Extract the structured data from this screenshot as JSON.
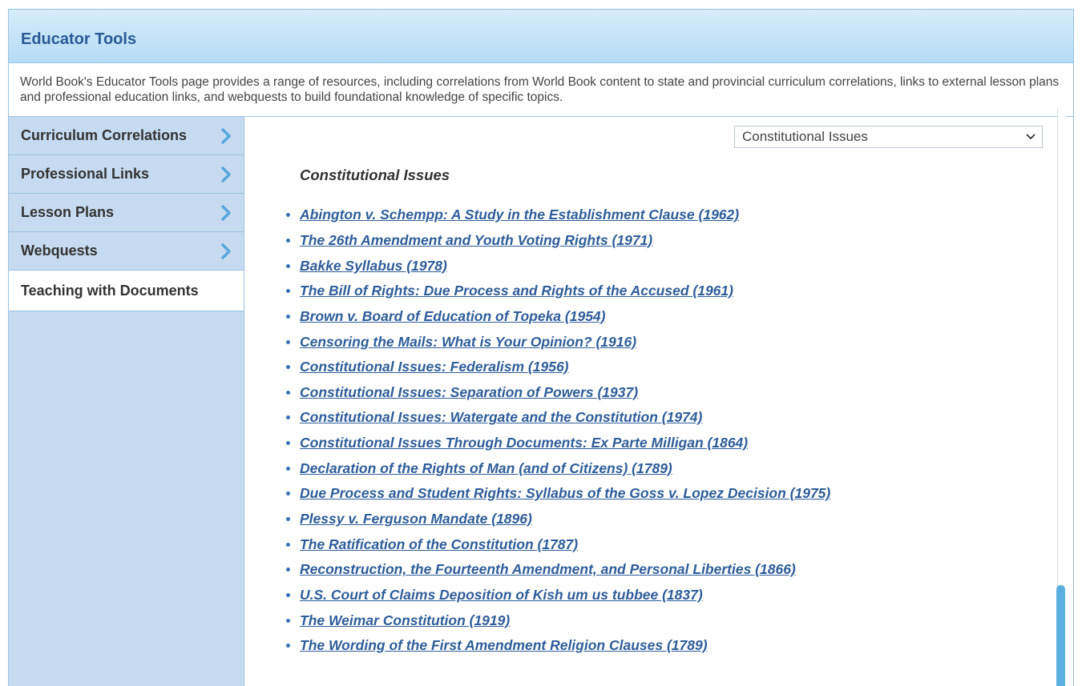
{
  "header": {
    "title": "Educator Tools"
  },
  "intro": {
    "text": "World Book's Educator Tools page provides a range of resources, including correlations from World Book content to state and provincial curriculum correlations, links to external lesson plans and professional education links, and webquests to build foundational knowledge of specific topics."
  },
  "sidebar": {
    "items": [
      {
        "label": "Curriculum Correlations",
        "icon": "chevron-right-icon"
      },
      {
        "label": "Professional Links",
        "icon": "chevron-right-icon"
      },
      {
        "label": "Lesson Plans",
        "icon": "chevron-right-icon"
      },
      {
        "label": "Webquests",
        "icon": "chevron-right-icon"
      },
      {
        "label": "Teaching with Documents",
        "active": true
      }
    ]
  },
  "topic_select": {
    "selected": "Constitutional Issues"
  },
  "section": {
    "title": "Constitutional Issues"
  },
  "documents": [
    "Abington v. Schempp: A Study in the Establishment Clause (1962)",
    "The 26th Amendment and Youth Voting Rights (1971)",
    "Bakke Syllabus (1978)",
    "The Bill of Rights: Due Process and Rights of the Accused (1961)",
    "Brown v. Board of Education of Topeka (1954)",
    "Censoring the Mails: What is Your Opinion? (1916)",
    "Constitutional Issues: Federalism (1956)",
    "Constitutional Issues: Separation of Powers (1937)",
    "Constitutional Issues: Watergate and the Constitution (1974)",
    "Constitutional Issues Through Documents: Ex Parte Milligan (1864)",
    "Declaration of the Rights of Man (and of Citizens) (1789)",
    "Due Process and Student Rights: Syllabus of the Goss v. Lopez Decision (1975)",
    "Plessy v. Ferguson Mandate (1896)",
    "The Ratification of the Constitution (1787)",
    "Reconstruction, the Fourteenth Amendment, and Personal Liberties (1866)",
    "U.S. Court of Claims Deposition of Kish um us tubbee (1837)",
    "The Weimar Constitution (1919)",
    "The Wording of the First Amendment Religion Clauses (1789)"
  ],
  "colors": {
    "header_title": "#2a5a95",
    "sidebar_bg": "#c6dbf0",
    "link": "#2e5d99",
    "chevron": "#5aa7dc",
    "scroll_thumb": "#5ab0df"
  }
}
